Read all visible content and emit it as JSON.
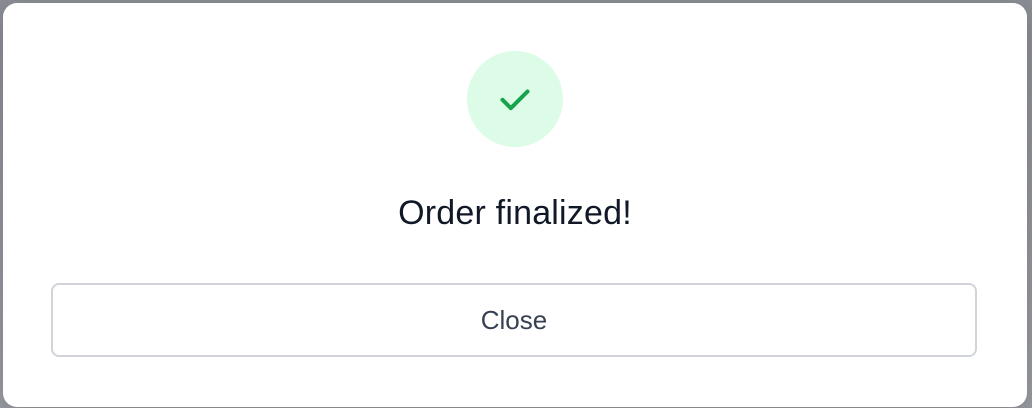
{
  "dialog": {
    "title": "Order finalized!",
    "close_label": "Close",
    "icon": "check-icon",
    "icon_color": "#16a34a",
    "icon_bg": "#dcfce7"
  }
}
